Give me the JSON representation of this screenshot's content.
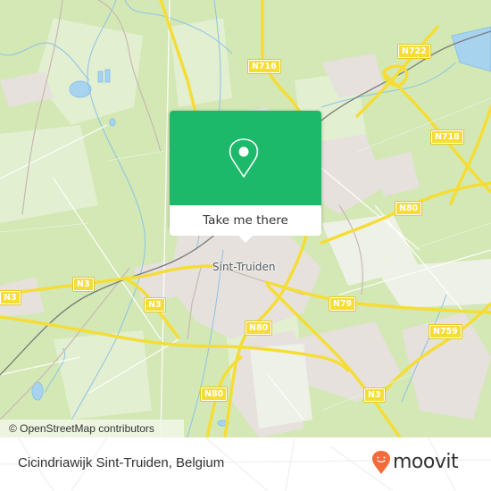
{
  "map": {
    "city_label": "Sint-Truiden",
    "road_labels": [
      {
        "id": "n716",
        "text": "N716"
      },
      {
        "id": "n722",
        "text": "N722"
      },
      {
        "id": "n718",
        "text": "N718"
      },
      {
        "id": "n80-east",
        "text": "N80"
      },
      {
        "id": "n3-west-edge",
        "text": "N3"
      },
      {
        "id": "n3-west",
        "text": "N3"
      },
      {
        "id": "n3-center",
        "text": "N3"
      },
      {
        "id": "n79",
        "text": "N79"
      },
      {
        "id": "n80-center",
        "text": "N80"
      },
      {
        "id": "n759",
        "text": "N759"
      },
      {
        "id": "n80-south",
        "text": "N80"
      },
      {
        "id": "n3-south",
        "text": "N3"
      }
    ],
    "attribution": "© OpenStreetMap contributors",
    "colors": {
      "forest": "#d3e8b4",
      "field": "#e2efd0",
      "urban": "#e6e1dc",
      "water": "#a8d3ef",
      "road": "#f5dd36",
      "rail": "#777777"
    }
  },
  "popup": {
    "icon": "map-pin-icon",
    "action_label": "Take me there",
    "accent_color": "#1db96a"
  },
  "footer": {
    "place_name": "Cicindriawijk Sint-Truiden, Belgium",
    "brand": "moovit",
    "brand_color": "#f26b3a"
  }
}
